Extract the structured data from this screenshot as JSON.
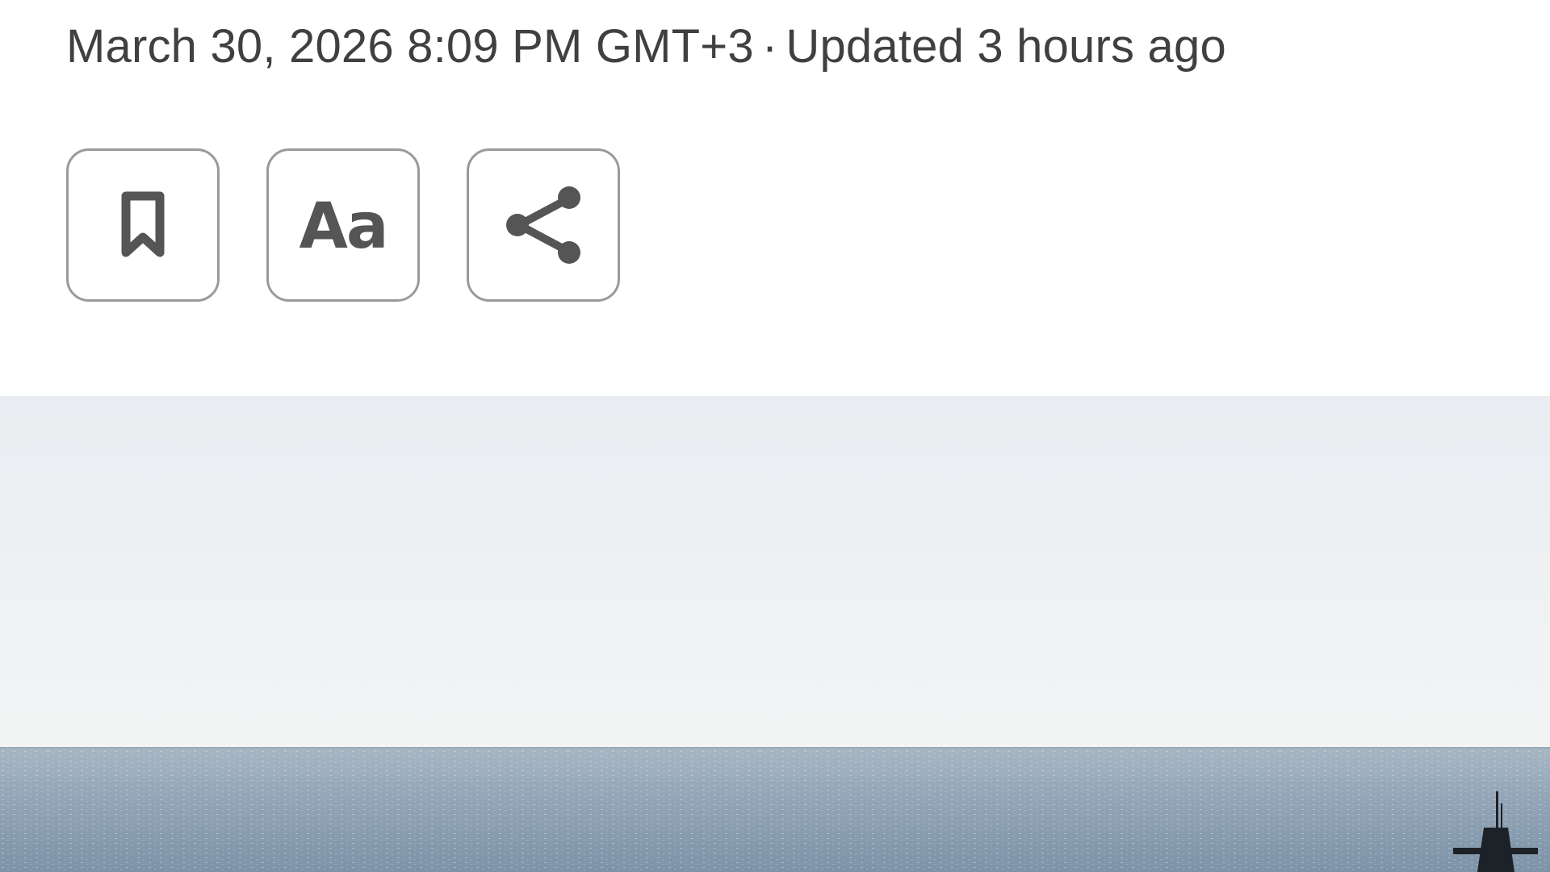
{
  "article": {
    "published": "March 30, 2026 8:09 PM GMT+3",
    "separator": "·",
    "updated": "Updated 3 hours ago"
  },
  "actions": [
    {
      "label": "Bookmark",
      "icon": "bookmark-icon"
    },
    {
      "label": "Aa",
      "icon": "text-size-icon"
    },
    {
      "label": "Share",
      "icon": "share-icon"
    }
  ],
  "hero_image": {
    "subject": "sea horizon with a submarine conning tower",
    "colors": {
      "sky": "#eef1f4",
      "sea": "#8fa4b6",
      "sub": "#1d2228"
    }
  }
}
